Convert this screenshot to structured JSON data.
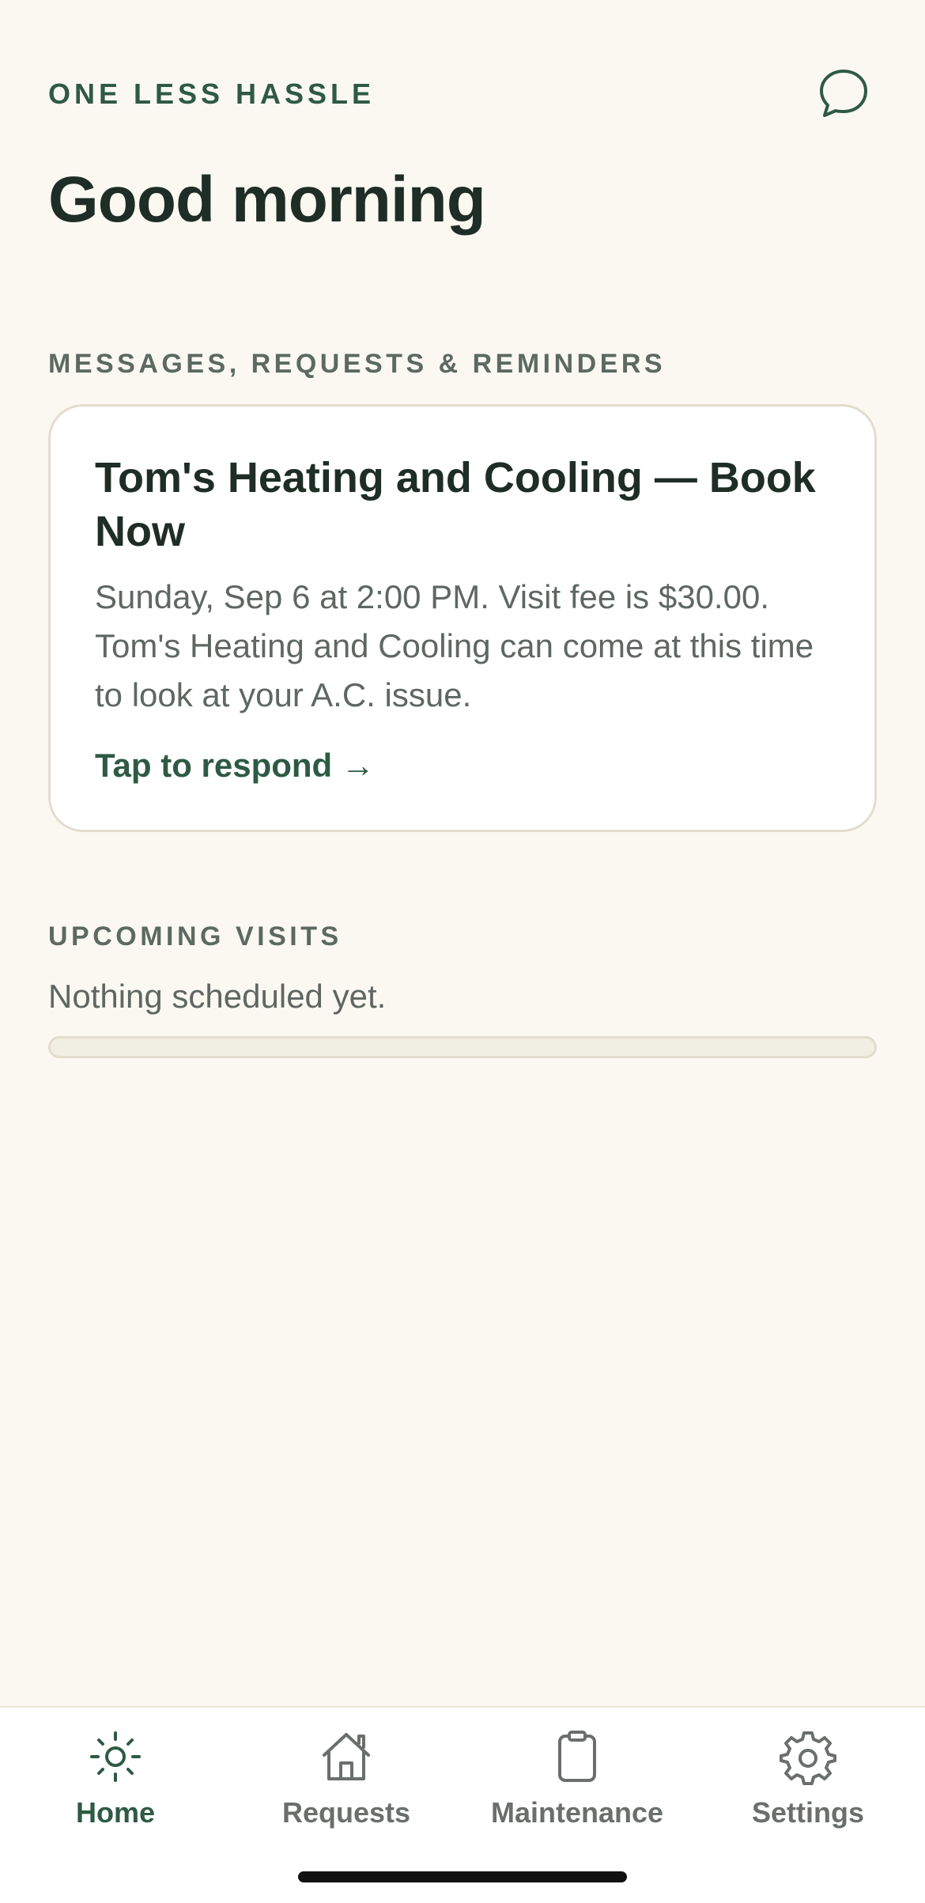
{
  "header": {
    "brand": "ONE LESS HASSLE",
    "greeting": "Good morning",
    "chat_icon": "chat-bubble-icon"
  },
  "messages": {
    "label": "MESSAGES, REQUESTS & REMINDERS",
    "card": {
      "title": "Tom's Heating and Cooling — Book Now",
      "body": "Sunday, Sep 6 at 2:00 PM. Visit fee is $30.00. Tom's Heating and Cooling can come at this time to look at your A.C. issue.",
      "action": "Tap to respond →"
    }
  },
  "upcoming": {
    "label": "UPCOMING VISITS",
    "empty": "Nothing scheduled yet."
  },
  "tabs": [
    {
      "label": "Home",
      "icon": "sun-icon",
      "active": true
    },
    {
      "label": "Requests",
      "icon": "house-icon",
      "active": false
    },
    {
      "label": "Maintenance",
      "icon": "clipboard-icon",
      "active": false
    },
    {
      "label": "Settings",
      "icon": "gear-icon",
      "active": false
    }
  ],
  "colors": {
    "accent": "#2E5A44",
    "background": "#FBF8F2",
    "card_border": "#E3DDCE"
  }
}
